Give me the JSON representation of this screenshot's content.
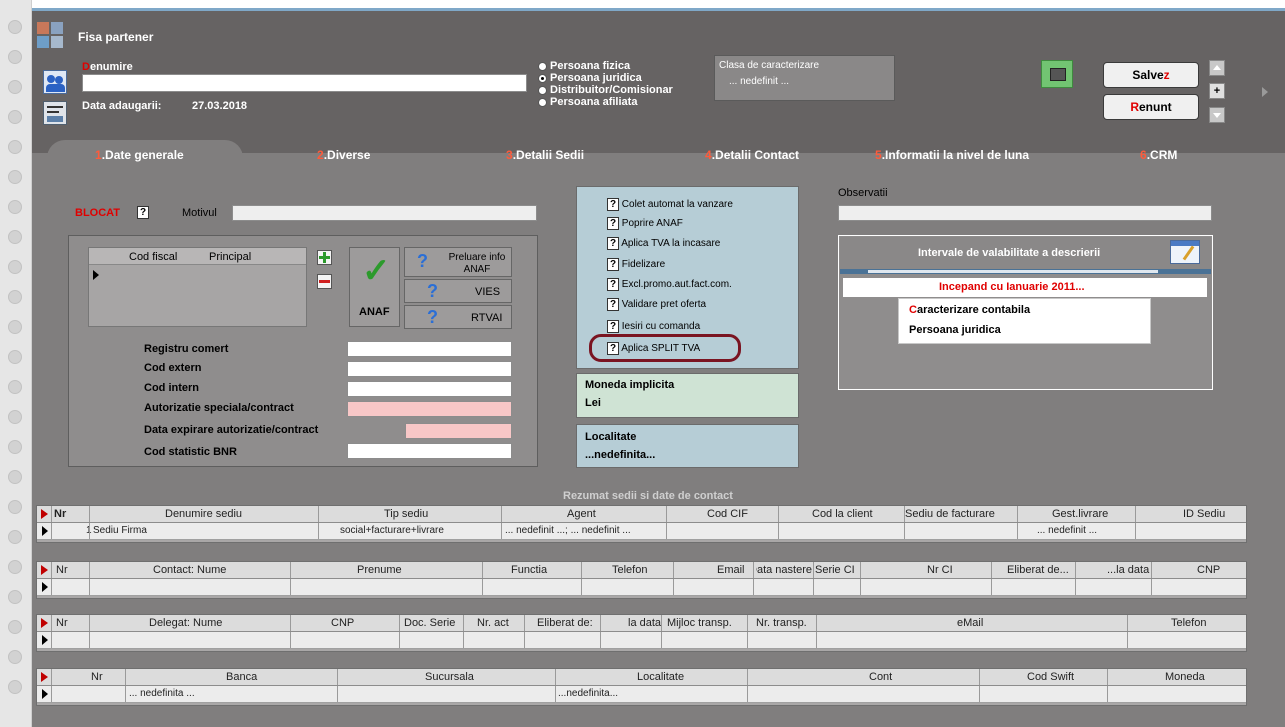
{
  "window": {
    "title": "Fisa partener"
  },
  "header": {
    "denumire_label_first": "D",
    "denumire_label_rest": "enumire",
    "denumire_value": "",
    "data_adaugarii_label": "Data adaugarii:",
    "data_adaugarii_value": "27.03.2018",
    "person_types": [
      "Persoana fizica",
      "Persoana juridica",
      "Distribuitor/Comisionar",
      "Persoana afiliata"
    ],
    "person_type_selected": "Persoana juridica",
    "clasa_label": "Clasa de caracterizare",
    "clasa_value": "... nedefinit ...",
    "salvez_label_main": "Salve",
    "salvez_label_accent": "z",
    "renunt_label_accent": "R",
    "renunt_label_main": "enunt",
    "plus_label": "+"
  },
  "tabs": [
    {
      "num": "1",
      "label": ".Date generale",
      "active": true
    },
    {
      "num": "2",
      "label": ".Diverse"
    },
    {
      "num": "3",
      "label": ".Detalii Sedii"
    },
    {
      "num": "4",
      "label": ".Detalii Contact"
    },
    {
      "num": "5",
      "label": ".Informatii la nivel de luna"
    },
    {
      "num": "6",
      "label": ".CRM"
    }
  ],
  "general": {
    "blocat_label": "BLOCAT",
    "question_mark": "?",
    "motivul_label": "Motivul",
    "motivul_value": "",
    "cod_fiscal_header": "Cod fiscal",
    "principal_header": "Principal",
    "anaf_label": "ANAF",
    "preluare_info_label": "Preluare info ANAF",
    "vies_label": "VIES",
    "rtvai_label": "RTVAI",
    "registru_comert_label": "Registru comert",
    "cod_extern_label": "Cod extern",
    "cod_intern_label": "Cod intern",
    "autorizatie_label": "Autorizatie speciala/contract",
    "data_expirare_label": "Data expirare autorizatie/contract",
    "cod_statistic_label": "Cod statistic BNR"
  },
  "options": [
    "Colet automat la vanzare",
    "Poprire ANAF",
    "Aplica TVA la incasare",
    "Fidelizare",
    "Excl.promo.aut.fact.com.",
    "Validare pret oferta",
    "Iesiri cu comanda",
    "Aplica SPLIT TVA"
  ],
  "moneda": {
    "label": "Moneda implicita",
    "value": "Lei"
  },
  "localitate": {
    "label": "Localitate",
    "value": "...nedefinita..."
  },
  "observatii": {
    "label": "Observatii",
    "value": ""
  },
  "intervale": {
    "title": "Intervale de valabilitate a descrierii",
    "period": "Incepand cu Ianuarie 2011...",
    "caracterizare_first": "C",
    "caracterizare_rest": "aracterizare contabila",
    "persoana": "Persoana juridica"
  },
  "summary_title": "Rezumat sedii si date de contact",
  "sedii_grid": {
    "headers": [
      "Nr",
      "Denumire sediu",
      "Tip sediu",
      "Agent",
      "Cod CIF",
      "Cod la client",
      "Sediu de facturare",
      "Gest.livrare",
      "ID Sediu"
    ],
    "row": [
      "1",
      "Sediu Firma",
      "social+facturare+livrare",
      "... nedefinit ...; ... nedefinit ...",
      "",
      "",
      "",
      "... nedefinit ...",
      ""
    ]
  },
  "contact_grid": {
    "headers": [
      "Nr",
      "Contact: Nume",
      "Prenume",
      "Functia",
      "Telefon",
      "Email",
      "Data nastere",
      "Serie CI",
      "Nr CI",
      "Eliberat de...",
      "...la data",
      "CNP"
    ]
  },
  "delegat_grid": {
    "headers": [
      "Nr",
      "Delegat: Nume",
      "CNP",
      "Doc. Serie",
      "Nr. act",
      "Eliberat de:",
      "la data",
      "Mijloc transp.",
      "Nr. transp.",
      "eMail",
      "Telefon"
    ]
  },
  "banca_grid": {
    "headers": [
      "Nr",
      "Banca",
      "Sucursala",
      "Localitate",
      "Cont",
      "Cod Swift",
      "Moneda"
    ],
    "row": [
      "",
      "... nedefinita ...",
      "",
      "...nedefinita...",
      "",
      "",
      ""
    ]
  }
}
